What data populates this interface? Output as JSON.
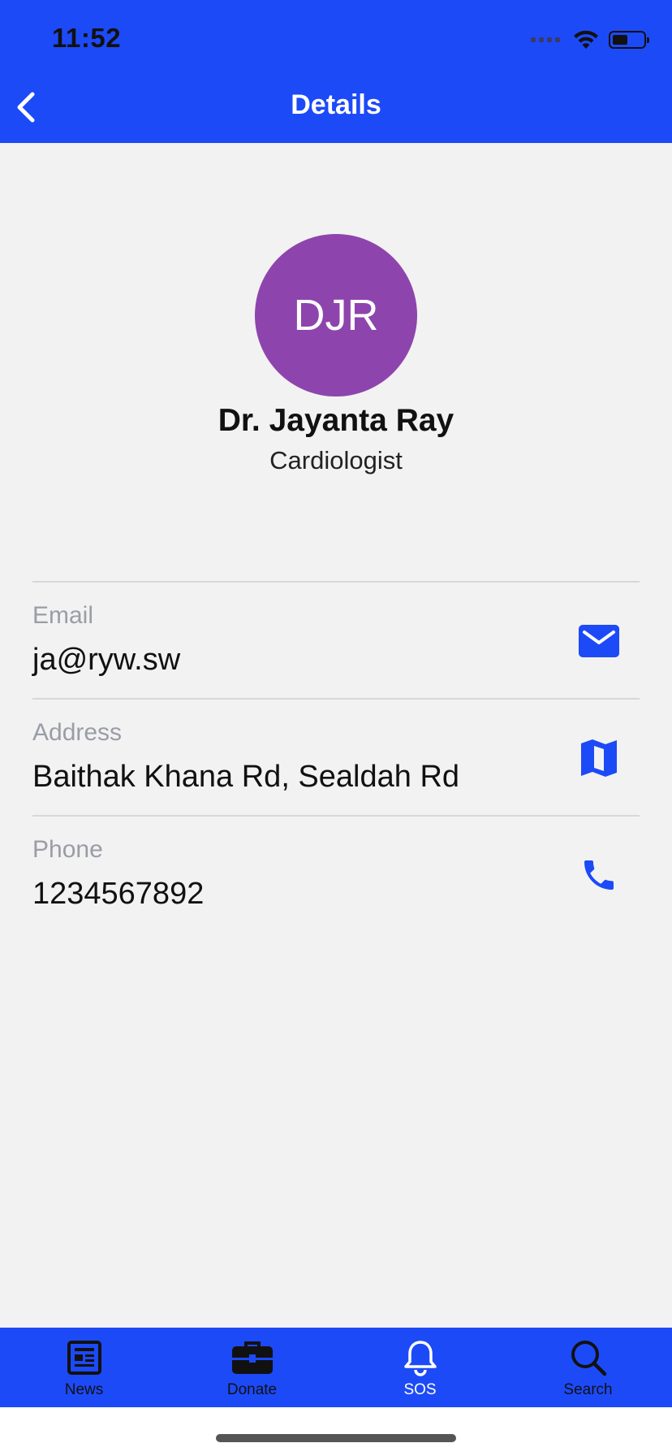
{
  "status_bar": {
    "time": "11:52"
  },
  "header": {
    "title": "Details"
  },
  "profile": {
    "initials": "DJR",
    "name": "Dr. Jayanta Ray",
    "role": "Cardiologist",
    "avatar_color": "#8e44ad"
  },
  "details": [
    {
      "label": "Email",
      "value": "ja@ryw.sw",
      "icon": "mail-icon"
    },
    {
      "label": "Address",
      "value": "Baithak Khana Rd, Sealdah Rd",
      "icon": "map-icon"
    },
    {
      "label": "Phone",
      "value": "1234567892",
      "icon": "phone-icon"
    }
  ],
  "tabs": [
    {
      "label": "News",
      "icon": "newspaper-icon"
    },
    {
      "label": "Donate",
      "icon": "briefcase-icon"
    },
    {
      "label": "SOS",
      "icon": "bell-icon",
      "active": true
    },
    {
      "label": "Search",
      "icon": "search-icon"
    }
  ],
  "colors": {
    "accent": "#1d4af7",
    "background": "#f2f2f2"
  }
}
